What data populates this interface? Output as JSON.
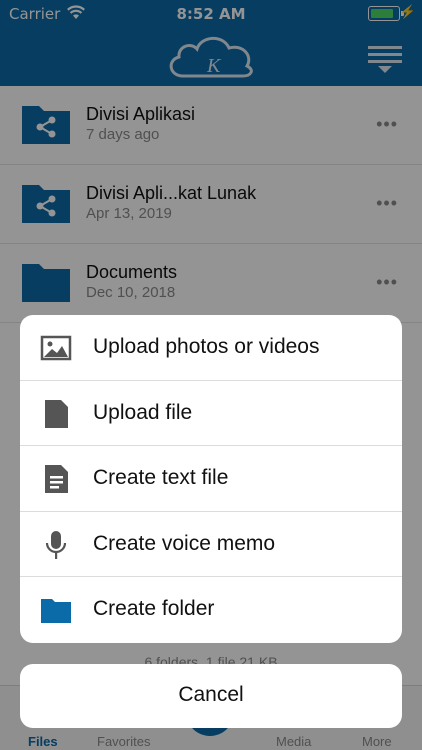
{
  "status_bar": {
    "carrier": "Carrier",
    "time": "8:52 AM"
  },
  "colors": {
    "brand": "#0b6aa8",
    "battery": "#4cd964"
  },
  "nav": {
    "logo_icon": "cloud-k-logo-icon",
    "menu_icon": "hamburger-menu-icon"
  },
  "files": [
    {
      "name": "Divisi Aplikasi",
      "date": "7 days ago",
      "icon": "shared-folder-icon"
    },
    {
      "name": "Divisi Apli...kat Lunak",
      "date": "Apr 13, 2019",
      "icon": "shared-folder-icon"
    },
    {
      "name": "Documents",
      "date": "Dec 10, 2018",
      "icon": "folder-icon"
    }
  ],
  "more_glyph": "•••",
  "summary": "6 folders, 1 file 21 KB",
  "tabs": [
    {
      "label": "Files",
      "active": true
    },
    {
      "label": "Favorites",
      "active": false
    },
    {
      "label": "Media",
      "active": false
    },
    {
      "label": "More",
      "active": false
    }
  ],
  "action_sheet": {
    "actions": [
      {
        "label": "Upload photos or videos",
        "icon": "photo-icon"
      },
      {
        "label": "Upload file",
        "icon": "file-icon"
      },
      {
        "label": "Create text file",
        "icon": "text-file-icon"
      },
      {
        "label": "Create voice memo",
        "icon": "microphone-icon"
      },
      {
        "label": "Create folder",
        "icon": "folder-icon"
      }
    ],
    "cancel": "Cancel"
  }
}
